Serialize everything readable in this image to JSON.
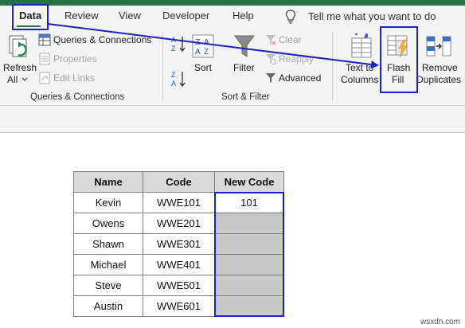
{
  "tabs": [
    "Data",
    "Review",
    "View",
    "Developer",
    "Help"
  ],
  "tell_me": "Tell me what you want to do",
  "ribbon": {
    "refresh_line1": "Refresh",
    "refresh_line2": "All",
    "queries_connections": "Queries & Connections",
    "properties": "Properties",
    "edit_links": "Edit Links",
    "group_queries": "Queries & Connections",
    "sort": "Sort",
    "filter": "Filter",
    "clear": "Clear",
    "reapply": "Reapply",
    "advanced": "Advanced",
    "group_sort_filter": "Sort & Filter",
    "text_to_line1": "Text to",
    "text_to_line2": "Columns",
    "flash_line1": "Flash",
    "flash_line2": "Fill",
    "remove_line1": "Remove",
    "remove_line2": "Duplicates"
  },
  "table": {
    "headers": [
      "Name",
      "Code",
      "New Code"
    ],
    "rows": [
      [
        "Kevin",
        "WWE101",
        "101"
      ],
      [
        "Owens",
        "WWE201",
        ""
      ],
      [
        "Shawn",
        "WWE301",
        ""
      ],
      [
        "Michael",
        "WWE401",
        ""
      ],
      [
        "Steve",
        "WWE501",
        ""
      ],
      [
        "Austin",
        "WWE601",
        ""
      ]
    ]
  },
  "watermark": "wsxdn.com",
  "colors": {
    "excel_green": "#217346",
    "highlight_blue": "#1f1fc8",
    "shaded_cell": "#c8c8c8"
  }
}
